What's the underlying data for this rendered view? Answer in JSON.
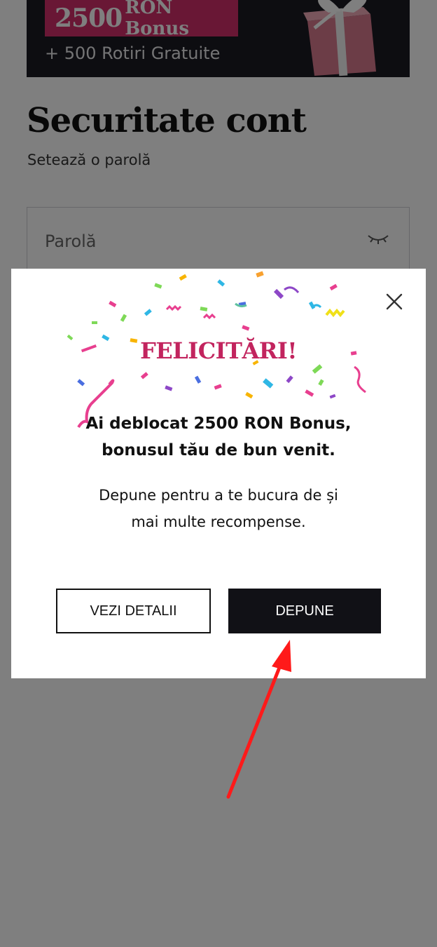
{
  "banner": {
    "bonus_amount": "2500",
    "bonus_currency": "RON Bonus",
    "free_spins": "+ 500 Rotiri Gratuite",
    "colors": {
      "background": "#1b1a22",
      "accent": "#d32f6b"
    }
  },
  "page": {
    "title": "Securitate cont",
    "subtitle": "Setează o parolă",
    "password_placeholder": "Parolă"
  },
  "modal": {
    "title": "FELICITĂRI!",
    "headline_line1": "Ai deblocat 2500 RON Bonus,",
    "headline_line2": "bonusul tău de bun venit.",
    "body_line1": "Depune pentru a te bucura de și",
    "body_line2": "mai multe recompense.",
    "details_button": "VEZI DETALII",
    "deposit_button": "DEPUNE",
    "colors": {
      "title": "#c2245e",
      "primary_button": "#111116"
    }
  },
  "icons": [
    "gift-icon",
    "eye-closed-icon",
    "close-icon",
    "confetti-decoration",
    "red-arrow-annotation"
  ]
}
